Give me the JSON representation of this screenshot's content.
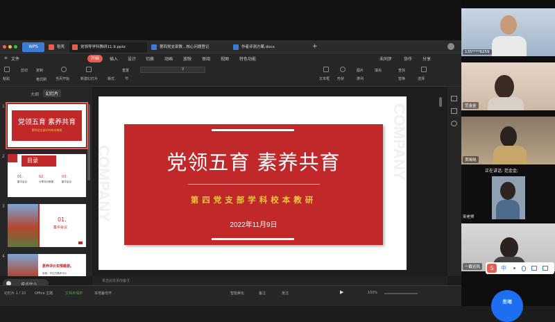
{
  "window": {
    "wps_label": "WPS",
    "tabs": [
      {
        "label": "稻壳",
        "color": "#e65c4f"
      },
      {
        "label": "党领导学科教研11.9.pptx",
        "color": "#e65c4f"
      },
      {
        "label": "第四党支部教…核心问题登记",
        "color": "#3a7bd5"
      },
      {
        "label": "作者评测方案.docx",
        "color": "#3a7bd5"
      }
    ]
  },
  "menu": {
    "file": "文件",
    "items": [
      "开始",
      "插入",
      "设计",
      "切换",
      "动画",
      "放映",
      "审阅",
      "视图",
      "特色功能"
    ],
    "right": [
      "未同步",
      "协作",
      "分享"
    ]
  },
  "toolbar": {
    "paste": "粘贴",
    "cut": "剪切",
    "copy": "复制",
    "format": "格式刷",
    "play": "当页开始",
    "new_slide": "新建幻灯片",
    "layout": "版式",
    "section": "节",
    "reset": "重置",
    "font_size": "0",
    "textbox": "文本框",
    "shape": "形状",
    "picture": "图片",
    "arrange": "排列",
    "fill": "填充",
    "find": "查找",
    "replace": "替换",
    "select": "选择"
  },
  "panel": {
    "outline_tab": "大纲",
    "slides_tab": "幻灯片"
  },
  "thumbnails": [
    {
      "num": "1",
      "title": "党领五育 素养共育",
      "sub": "第四党支部学科校本教研"
    },
    {
      "num": "2",
      "title": "目录",
      "items": [
        "01.",
        "02.",
        "03."
      ],
      "item_texts": [
        "集中会议",
        "分享评价数据",
        "集中会议"
      ]
    },
    {
      "num": "3",
      "title": "01.",
      "sub": "集中会议"
    },
    {
      "num": "4",
      "title": "素养评价实情概要。",
      "sub": "前期，学生的素养评价"
    }
  ],
  "slide": {
    "title": "党领五育  素养共育",
    "subtitle": "第四党支部学科校本教研",
    "date": "2022年11月9日",
    "ghost_text": "COMPANY"
  },
  "notes_placeholder": "单击此处添加备注",
  "status": {
    "slide_info": "幻灯片 1 / 10",
    "theme": "Office 主题",
    "doc_protect": "文档未保护",
    "backup": "本地备份开",
    "smart": "智能美化",
    "notes": "备注",
    "comment": "批注",
    "zoom": "100%"
  },
  "chat_hint": "说点什么...",
  "video": {
    "tiles": [
      {
        "name": "135****6259"
      },
      {
        "name": "范金金"
      },
      {
        "name": "贾晓晓"
      },
      {
        "name": "宋老师"
      },
      {
        "name": "一截迟风"
      }
    ],
    "speaking": "正在讲话: 范金金;",
    "button": "墨曦"
  },
  "ime": {
    "label": "中"
  }
}
